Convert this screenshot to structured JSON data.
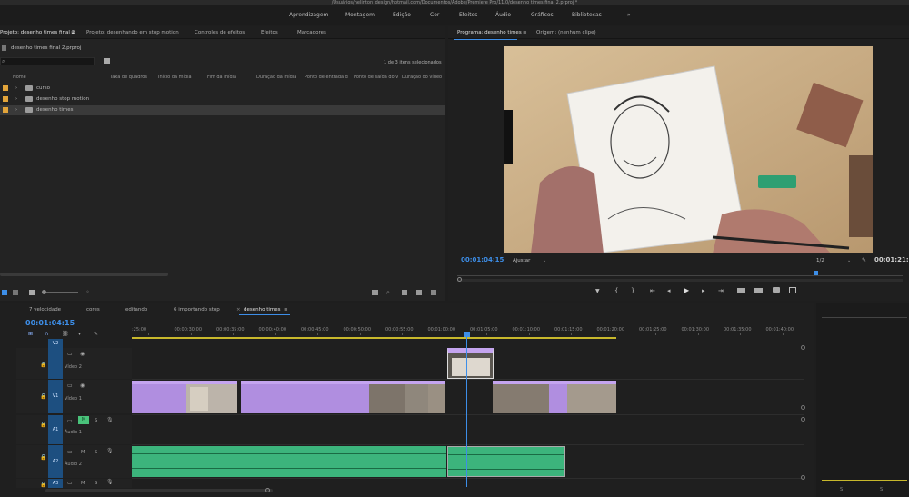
{
  "title_path": "/Usuários/helinton_design/hotmail.com/Documentos/Adobe/Premiere Pro/11.0/desenho times final 2.prproj *",
  "workspaces": [
    "Aprendizagem",
    "Montagem",
    "Edição",
    "Cor",
    "Efeitos",
    "Áudio",
    "Gráficos",
    "Bibliotecas"
  ],
  "workspace_more": "»",
  "project_panel": {
    "tabs": [
      "Projeto: desenho times final 2",
      "Projeto: desenhando em stop motion",
      "Controles de efeitos",
      "Efeitos",
      "Marcadores"
    ],
    "menu_icon": "≡",
    "project_file": "desenho times final 2.prproj",
    "search_placeholder": "",
    "items_selected": "1 de 3 itens selecionados",
    "columns": [
      "Nome",
      "Taxa de quadros",
      "Início da mídia",
      "Fim da mídia",
      "Duração da mídia",
      "Ponto de entrada d",
      "Ponto de saída do v",
      "Duração do vídeo"
    ],
    "rows": [
      {
        "name": "curso",
        "color": "#e2a43a"
      },
      {
        "name": "desenho stop motion",
        "color": "#e2a43a"
      },
      {
        "name": "desenho times",
        "color": "#e2a43a"
      }
    ]
  },
  "program_monitor": {
    "tab_program": "Programa: desenho times",
    "tab_source": "Origem: (nenhum clipe)",
    "menu_icon": "≡",
    "timecode": "00:01:04:15",
    "fit": "Ajustar",
    "resolution": "1/2",
    "duration": "00:01:21:5"
  },
  "timeline": {
    "tabs": [
      "7 velocidade",
      "cores",
      "editando",
      "6 importando stop",
      "desenho times"
    ],
    "active_tab": "desenho times",
    "timecode": "00:01:04:15",
    "ruler": [
      ":25:00",
      "00:00:30:00",
      "00:00:35:00",
      "00:00:40:00",
      "00:00:45:00",
      "00:00:50:00",
      "00:00:55:00",
      "00:01:00:00",
      "00:01:05:00",
      "00:01:10:00",
      "00:01:15:00",
      "00:01:20:00",
      "00:01:25:00",
      "00:01:30:00",
      "00:01:35:00",
      "00:01:40:00"
    ],
    "tracks": {
      "v2": {
        "target": "V2",
        "name": "Vídeo 2"
      },
      "v1": {
        "target": "V1",
        "name": "Vídeo 1"
      },
      "a1": {
        "target": "A1",
        "name": "Áudio 1"
      },
      "a2": {
        "target": "A2",
        "name": "Áudio 2"
      },
      "a3": {
        "target": "A3"
      }
    },
    "track_labels": {
      "mute": "M",
      "solo": "S"
    },
    "clip_label": "61.JPG"
  },
  "colors": {
    "accent": "#3d8ee8",
    "video_clip": "#b08ee0",
    "audio_clip": "#3cb47c",
    "label_orange": "#e2a43a"
  }
}
